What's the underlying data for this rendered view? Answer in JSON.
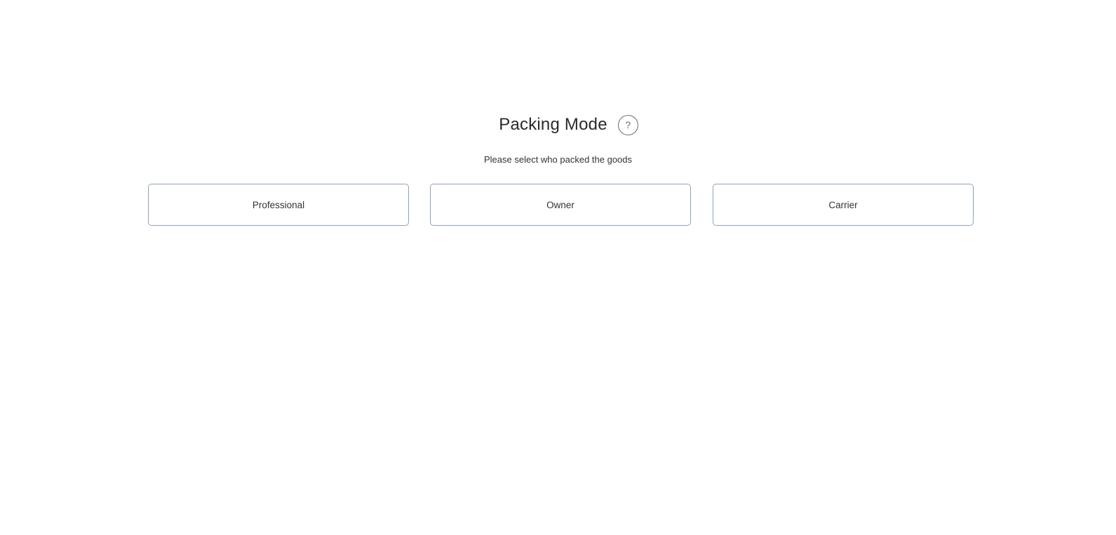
{
  "header": {
    "title": "Packing Mode",
    "help_label": "?",
    "help_icon": "question-mark-icon"
  },
  "subtitle": "Please select who packed the goods",
  "options": [
    {
      "label": "Professional"
    },
    {
      "label": "Owner"
    },
    {
      "label": "Carrier"
    }
  ],
  "colors": {
    "option_border": "#8fa3b6",
    "text": "#333333",
    "background": "#ffffff"
  }
}
